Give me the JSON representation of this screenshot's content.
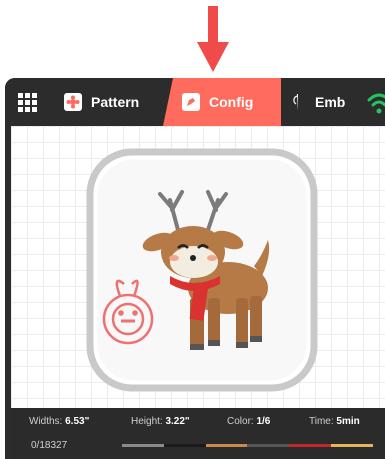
{
  "colors": {
    "accent": "#ff6b5d",
    "topbar": "#2c2c2c",
    "statusbar": "#2b2b2b",
    "wifi": "#22c55e"
  },
  "tabs": [
    {
      "label": "Pattern",
      "icon": "pattern-icon"
    },
    {
      "label": "Config",
      "icon": "config-icon",
      "active": true
    },
    {
      "label": "Emb",
      "icon": "needle-icon"
    }
  ],
  "status": {
    "width_label": "Widths:",
    "width_value": "6.53\"",
    "height_label": "Height:",
    "height_value": "3.22\"",
    "color_label": "Color:",
    "color_value": "1/6",
    "time_label": "Time:",
    "time_value": "5min",
    "stitch_counter": "0/18327",
    "thread_colors": [
      "#8a8a8a",
      "#1a1a1a",
      "#c98a4a",
      "#555555",
      "#c0282a",
      "#e0b85c"
    ]
  }
}
